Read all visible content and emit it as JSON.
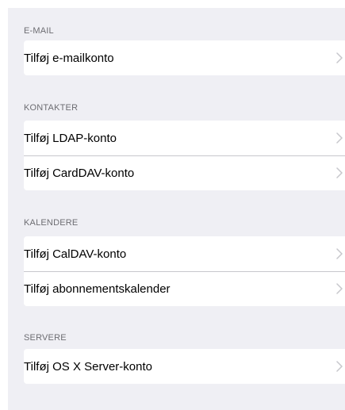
{
  "sections": [
    {
      "header": "E-MAIL",
      "rows": [
        {
          "label": "Tilføj e-mailkonto"
        }
      ]
    },
    {
      "header": "KONTAKTER",
      "rows": [
        {
          "label": "Tilføj LDAP-konto"
        },
        {
          "label": "Tilføj CardDAV-konto"
        }
      ]
    },
    {
      "header": "KALENDERE",
      "rows": [
        {
          "label": "Tilføj CalDAV-konto"
        },
        {
          "label": "Tilføj abonnementskalender"
        }
      ]
    },
    {
      "header": "SERVERE",
      "rows": [
        {
          "label": "Tilføj OS X Server-konto"
        }
      ]
    }
  ],
  "icons": {
    "row_accessory": "chevron-right-icon"
  },
  "colors": {
    "background": "#efeff4",
    "cell": "#ffffff",
    "header_text": "#6d6d72",
    "separator": "#c8c7cc",
    "chevron": "#c7c7cc"
  }
}
